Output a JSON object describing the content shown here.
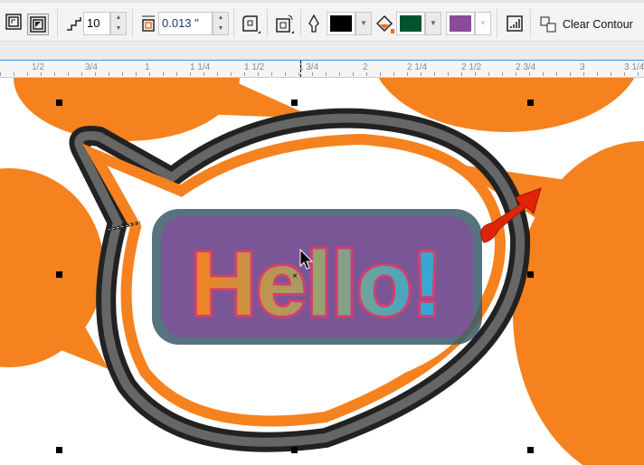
{
  "toolbar": {
    "steps_value": "10",
    "offset_value": "0.013 \"",
    "outline_color": "#000000",
    "fill_color": "#00532e",
    "fill_end_color": "#8b4a9c",
    "clear_contour_label": "Clear Contour"
  },
  "ruler": {
    "labels": [
      "1/2",
      "3/4",
      "1",
      "1  1/4",
      "1  1/2",
      "1  3/4",
      "2",
      "2  1/4",
      "2  1/2",
      "2  3/4",
      "3",
      "3  1/4"
    ]
  },
  "canvas": {
    "text": "Hello!",
    "accent": "#f5821f"
  }
}
